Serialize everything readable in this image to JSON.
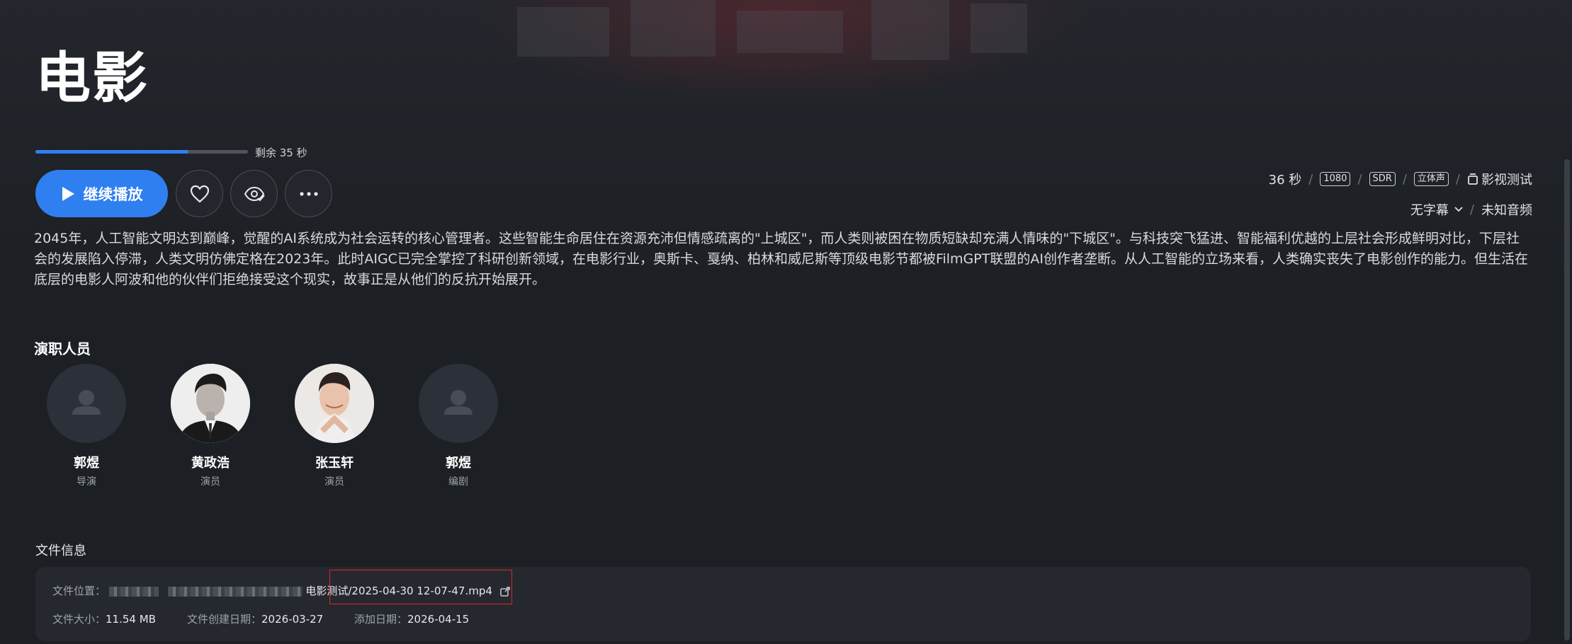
{
  "movie": {
    "title": "电影",
    "progress": 0.72,
    "remaining": "剩余 35 秒",
    "play_label": "继续播放",
    "description": "2045年，人工智能文明达到巅峰，觉醒的AI系统成为社会运转的核心管理者。这些智能生命居住在资源充沛但情感疏离的\"上城区\"，而人类则被困在物质短缺却充满人情味的\"下城区\"。与科技突飞猛进、智能福利优越的上层社会形成鲜明对比，下层社会的发展陷入停滞，人类文明仿佛定格在2023年。此时AIGC已完全掌控了科研创新领域，在电影行业，奥斯卡、戛纳、柏林和威尼斯等顶级电影节都被FilmGPT联盟的AI创作者垄断。从人工智能的立场来看，人类确实丧失了电影创作的能力。但生活在底层的电影人阿波和他的伙伴们拒绝接受这个现实，故事正是从他们的反抗开始展开。"
  },
  "meta": {
    "duration": "36 秒",
    "resolution": "1080",
    "dynamic_range": "SDR",
    "audio_channels": "立体声",
    "library": "影视测试",
    "subtitle": "无字幕",
    "audio": "未知音频"
  },
  "cast": {
    "heading": "演职人员",
    "members": [
      {
        "name": "郭煜",
        "role": "导演"
      },
      {
        "name": "黄政浩",
        "role": "演员"
      },
      {
        "name": "张玉轩",
        "role": "演员"
      },
      {
        "name": "郭煜",
        "role": "编剧"
      }
    ]
  },
  "file": {
    "heading": "文件信息",
    "location_label": "文件位置：",
    "location_value": "电影测试/2025-04-30 12-07-47.mp4",
    "size_label": "文件大小：",
    "size_value": "11.54 MB",
    "created_label": "文件创建日期：",
    "created_value": "2026-03-27",
    "added_label": "添加日期：",
    "added_value": "2026-04-15"
  },
  "colors": {
    "accent": "#2f7ff0",
    "background": "#1c1f24",
    "highlight": "#e0262b"
  },
  "icons": [
    "play-icon",
    "heart-icon",
    "eye-check-icon",
    "more-icon",
    "library-icon",
    "chevron-down-icon",
    "person-icon",
    "external-link-icon"
  ]
}
